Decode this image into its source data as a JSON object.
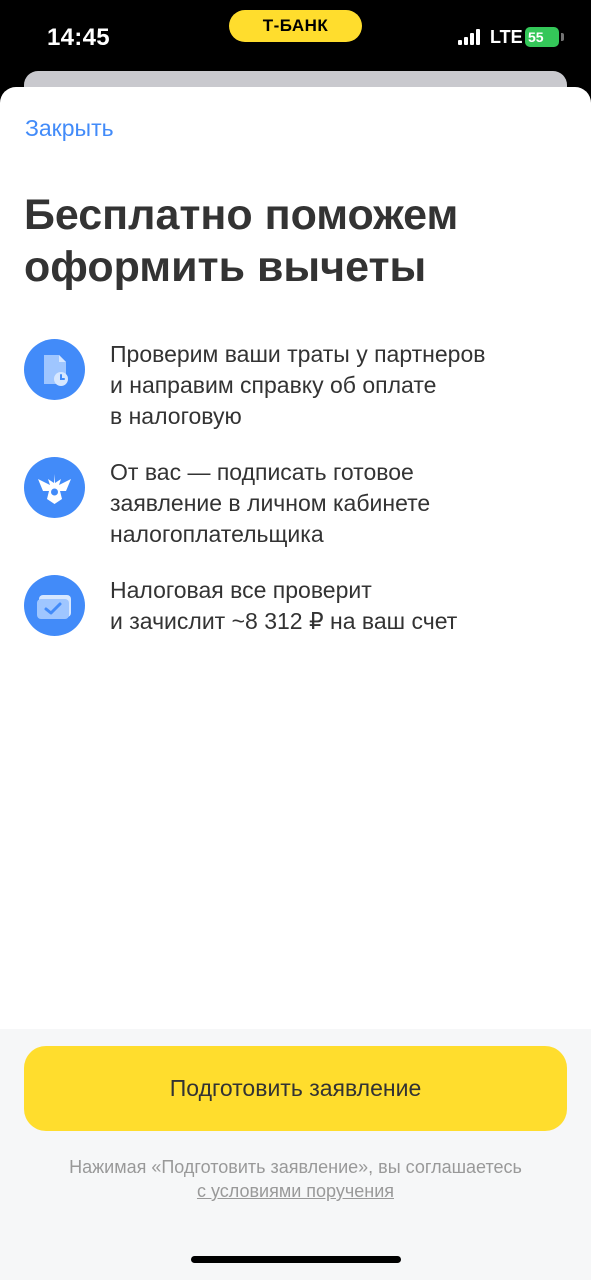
{
  "status_bar": {
    "time": "14:45",
    "brand": "Т-БАНК",
    "network": "LTE",
    "battery": "55",
    "brand_color": "#FFDD2D",
    "battery_color": "#34C759"
  },
  "sheet": {
    "close_label": "Закрыть",
    "title_line1": "Бесплатно поможем",
    "title_line2": "оформить вычеты",
    "features": [
      {
        "icon": "document-clock-icon",
        "lines": [
          "Проверим ваши траты у партнеров",
          "и направим справку об оплате",
          "в налоговую"
        ]
      },
      {
        "icon": "emblem-eagle-icon",
        "lines": [
          "От вас — подписать готовое",
          "заявление в личном кабинете",
          "налогоплательщика"
        ]
      },
      {
        "icon": "card-check-icon",
        "lines": [
          "Налоговая все проверит",
          "и зачислит ~8 312 ₽ на ваш счет"
        ]
      }
    ],
    "accent_color": "#428BF9"
  },
  "footer": {
    "button_label": "Подготовить заявление",
    "consent_text": "Нажимая «Подготовить заявление», вы соглашаетесь",
    "consent_link": "с условиями поручения"
  }
}
